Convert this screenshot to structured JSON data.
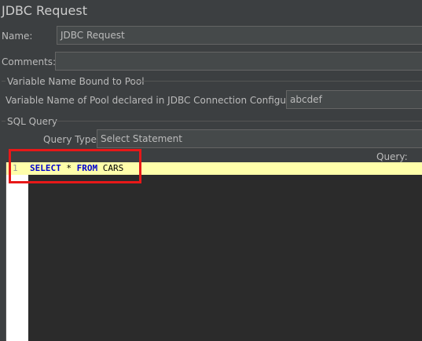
{
  "panel": {
    "title": "JDBC Request"
  },
  "name": {
    "label": "Name:",
    "value": "JDBC Request"
  },
  "comments": {
    "label": "Comments:",
    "value": ""
  },
  "pool_section": {
    "title": "Variable Name Bound to Pool",
    "pool_label": "Variable Name of Pool declared in JDBC Connection Configuration:",
    "pool_value": "abcdef"
  },
  "sql_section": {
    "title": "SQL Query",
    "query_type_label": "Query Type:",
    "query_type_value": "Select Statement",
    "query_label": "Query:"
  },
  "editor": {
    "line_number": "1",
    "tokens": {
      "kw1": "SELECT",
      "star": "*",
      "kw2": "FROM",
      "table": "CARS"
    }
  },
  "colors": {
    "background": "#3c3f41",
    "current_line": "#ffffaa",
    "keyword": "#0000cc",
    "highlight_box": "#e81818"
  }
}
